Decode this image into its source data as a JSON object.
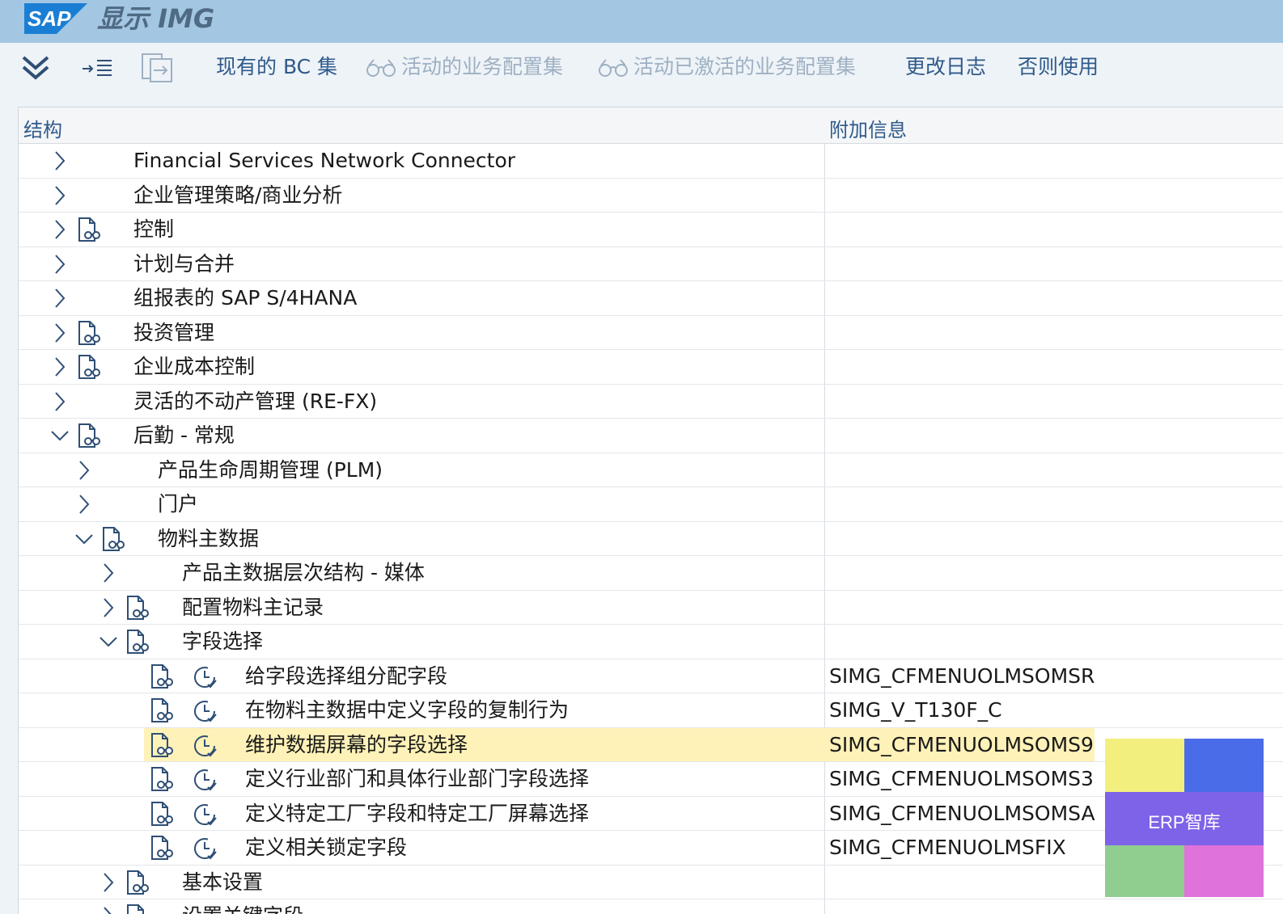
{
  "app": {
    "logo_text": "SAP",
    "title": "显示 IMG"
  },
  "toolbar": {
    "bc_sets_label": "现有的 BC 集",
    "active_bc_sets_label": "活动的业务配置集",
    "activated_bc_sets_label": "活动已激活的业务配置集",
    "change_log_label": "更改日志",
    "otherwise_use_label": "否则使用"
  },
  "grid": {
    "col_structure": "结构",
    "col_info": "附加信息",
    "rows": [
      {
        "label": "Financial Services Network Connector",
        "info": "",
        "level": 0,
        "expand": "collapsed",
        "doc": false,
        "clock": false
      },
      {
        "label": "企业管理策略/商业分析",
        "info": "",
        "level": 0,
        "expand": "collapsed",
        "doc": false,
        "clock": false
      },
      {
        "label": "控制",
        "info": "",
        "level": 0,
        "expand": "collapsed",
        "doc": true,
        "clock": false
      },
      {
        "label": "计划与合并",
        "info": "",
        "level": 0,
        "expand": "collapsed",
        "doc": false,
        "clock": false
      },
      {
        "label": "组报表的 SAP S/4HANA",
        "info": "",
        "level": 0,
        "expand": "collapsed",
        "doc": false,
        "clock": false
      },
      {
        "label": "投资管理",
        "info": "",
        "level": 0,
        "expand": "collapsed",
        "doc": true,
        "clock": false
      },
      {
        "label": "企业成本控制",
        "info": "",
        "level": 0,
        "expand": "collapsed",
        "doc": true,
        "clock": false
      },
      {
        "label": "灵活的不动产管理 (RE-FX)",
        "info": "",
        "level": 0,
        "expand": "collapsed",
        "doc": false,
        "clock": false
      },
      {
        "label": "后勤 - 常规",
        "info": "",
        "level": 0,
        "expand": "expanded",
        "doc": true,
        "clock": false
      },
      {
        "label": "产品生命周期管理 (PLM)",
        "info": "",
        "level": 1,
        "expand": "collapsed",
        "doc": false,
        "clock": false
      },
      {
        "label": "门户",
        "info": "",
        "level": 1,
        "expand": "collapsed",
        "doc": false,
        "clock": false
      },
      {
        "label": "物料主数据",
        "info": "",
        "level": 1,
        "expand": "expanded",
        "doc": true,
        "clock": false
      },
      {
        "label": "产品主数据层次结构 - 媒体",
        "info": "",
        "level": 2,
        "expand": "collapsed",
        "doc": false,
        "clock": false
      },
      {
        "label": "配置物料主记录",
        "info": "",
        "level": 2,
        "expand": "collapsed",
        "doc": true,
        "clock": false
      },
      {
        "label": "字段选择",
        "info": "",
        "level": 2,
        "expand": "expanded",
        "doc": true,
        "clock": false
      },
      {
        "label": "给字段选择组分配字段",
        "info": "SIMG_CFMENUOLMSOMSR",
        "level": 3,
        "expand": "none",
        "doc": true,
        "clock": true
      },
      {
        "label": "在物料主数据中定义字段的复制行为",
        "info": "SIMG_V_T130F_C",
        "level": 3,
        "expand": "none",
        "doc": true,
        "clock": true
      },
      {
        "label": "维护数据屏幕的字段选择",
        "info": "SIMG_CFMENUOLMSOMS9",
        "level": 3,
        "expand": "none",
        "doc": true,
        "clock": true,
        "selected": true
      },
      {
        "label": "定义行业部门和具体行业部门字段选择",
        "info": "SIMG_CFMENUOLMSOMS3",
        "level": 3,
        "expand": "none",
        "doc": true,
        "clock": true
      },
      {
        "label": "定义特定工厂字段和特定工厂屏幕选择",
        "info": "SIMG_CFMENUOLMSOMSA",
        "level": 3,
        "expand": "none",
        "doc": true,
        "clock": true
      },
      {
        "label": "定义相关锁定字段",
        "info": "SIMG_CFMENUOLMSFIX",
        "level": 3,
        "expand": "none",
        "doc": true,
        "clock": true
      },
      {
        "label": "基本设置",
        "info": "",
        "level": 2,
        "expand": "collapsed",
        "doc": true,
        "clock": false
      },
      {
        "label": "设置关键字段",
        "info": "",
        "level": 2,
        "expand": "collapsed",
        "doc": true,
        "clock": false
      }
    ]
  },
  "watermark": {
    "text": "ERP智库"
  },
  "colors": {
    "titlebar": "#a3c6e3",
    "link": "#2f5a8a",
    "selected_row": "#fff2b8"
  }
}
